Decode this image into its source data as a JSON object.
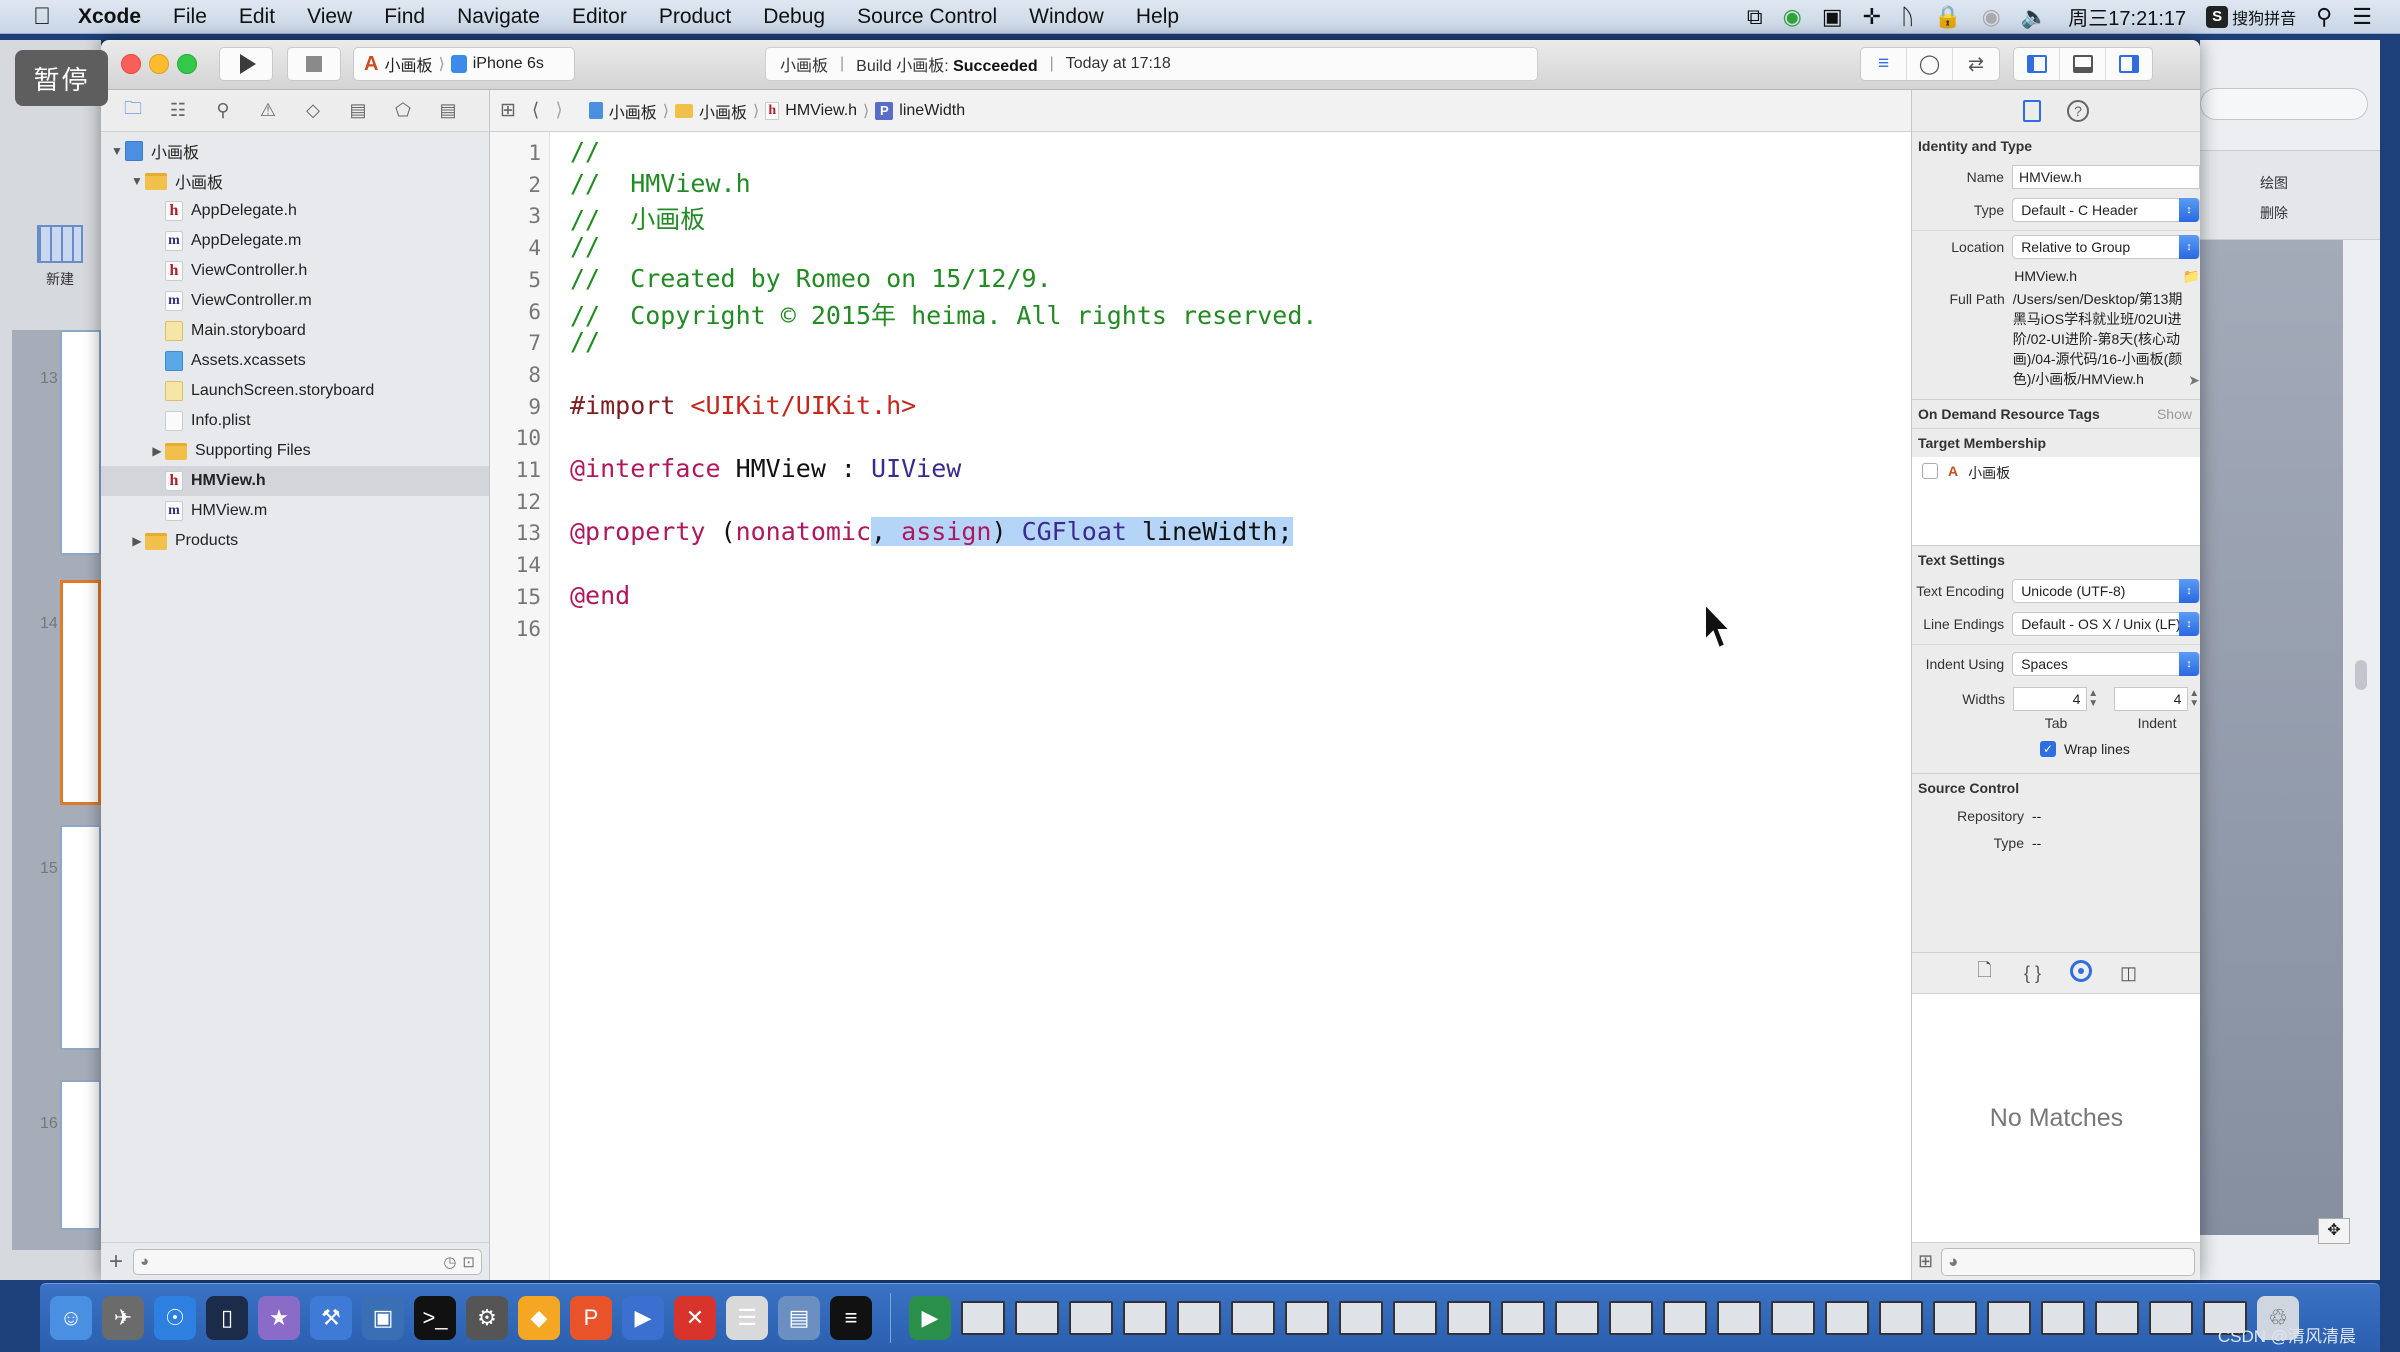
{
  "menubar": {
    "apple_icon": "apple-logo-icon",
    "items": [
      "Xcode",
      "File",
      "Edit",
      "View",
      "Find",
      "Navigate",
      "Editor",
      "Product",
      "Debug",
      "Source Control",
      "Window",
      "Help"
    ],
    "status_icons": [
      "window-switch-icon",
      "green-app-icon",
      "camera-icon",
      "plane-icon",
      "bluetooth-icon",
      "lock-icon",
      "wifi-icon",
      "volume-icon"
    ],
    "clock": "周三17:21:17",
    "input_method": "搜狗拼音",
    "search_icon": "spotlight-search-icon",
    "notification_icon": "notification-list-icon"
  },
  "overlay": {
    "pause_badge": "暂停"
  },
  "background_app": {
    "new_label": "新建",
    "slide_numbers": [
      "13",
      "14",
      "15",
      "16"
    ],
    "right_ribbon": [
      "绘图",
      "删除"
    ]
  },
  "toolbar": {
    "scheme_name": "小画板",
    "device": "iPhone 6s",
    "activity": {
      "project": "小画板",
      "build_prefix": "Build 小画板:",
      "build_status": "Succeeded",
      "time": "Today at 17:18"
    }
  },
  "navigator": {
    "tabs": [
      "project-navigator",
      "symbol-navigator",
      "find-navigator",
      "issue-navigator",
      "test-navigator",
      "debug-navigator",
      "breakpoint-navigator",
      "report-navigator"
    ],
    "tree": [
      {
        "label": "小画板",
        "type": "project",
        "level": 0,
        "expanded": true
      },
      {
        "label": "小画板",
        "type": "folder",
        "level": 1,
        "expanded": true
      },
      {
        "label": "AppDelegate.h",
        "type": "h",
        "level": 2
      },
      {
        "label": "AppDelegate.m",
        "type": "m",
        "level": 2
      },
      {
        "label": "ViewController.h",
        "type": "h",
        "level": 2
      },
      {
        "label": "ViewController.m",
        "type": "m",
        "level": 2
      },
      {
        "label": "Main.storyboard",
        "type": "storyboard",
        "level": 2
      },
      {
        "label": "Assets.xcassets",
        "type": "xcassets",
        "level": 2
      },
      {
        "label": "LaunchScreen.storyboard",
        "type": "storyboard",
        "level": 2
      },
      {
        "label": "Info.plist",
        "type": "plist",
        "level": 2
      },
      {
        "label": "Supporting Files",
        "type": "folder",
        "level": 2,
        "expanded": false
      },
      {
        "label": "HMView.h",
        "type": "h",
        "level": 2,
        "selected": true
      },
      {
        "label": "HMView.m",
        "type": "m",
        "level": 2
      },
      {
        "label": "Products",
        "type": "folder",
        "level": 1,
        "expanded": false
      }
    ]
  },
  "jumpbar": {
    "crumbs": [
      "小画板",
      "小画板",
      "HMView.h",
      "lineWidth"
    ]
  },
  "editor": {
    "lines": [
      {
        "n": "1",
        "parts": [
          {
            "t": "//",
            "c": "com"
          }
        ]
      },
      {
        "n": "2",
        "parts": [
          {
            "t": "//  HMView.h",
            "c": "com"
          }
        ]
      },
      {
        "n": "3",
        "parts": [
          {
            "t": "//  小画板",
            "c": "com"
          }
        ]
      },
      {
        "n": "4",
        "parts": [
          {
            "t": "//",
            "c": "com"
          }
        ]
      },
      {
        "n": "5",
        "parts": [
          {
            "t": "//  Created by Romeo on 15/12/9.",
            "c": "com"
          }
        ]
      },
      {
        "n": "6",
        "parts": [
          {
            "t": "//  Copyright © 2015年 heima. All rights reserved.",
            "c": "com"
          }
        ]
      },
      {
        "n": "7",
        "parts": [
          {
            "t": "//",
            "c": "com"
          }
        ]
      },
      {
        "n": "8",
        "parts": []
      },
      {
        "n": "9",
        "parts": [
          {
            "t": "#import ",
            "c": "pre"
          },
          {
            "t": "<UIKit/UIKit.h>",
            "c": "str"
          }
        ]
      },
      {
        "n": "10",
        "parts": []
      },
      {
        "n": "11",
        "parts": [
          {
            "t": "@interface",
            "c": "kw"
          },
          {
            "t": " HMView : ",
            "c": "nm"
          },
          {
            "t": "UIView",
            "c": "cls"
          }
        ]
      },
      {
        "n": "12",
        "parts": []
      },
      {
        "n": "13",
        "parts": [
          {
            "t": "@property",
            "c": "kw"
          },
          {
            "t": " (",
            "c": "nm"
          },
          {
            "t": "nonatomic",
            "c": "kw"
          },
          {
            "t": ", ",
            "c": "nm",
            "sel": true
          },
          {
            "t": "assign",
            "c": "kw",
            "sel": true
          },
          {
            "t": ") ",
            "c": "nm",
            "sel": true
          },
          {
            "t": "CGFloat",
            "c": "cls",
            "sel": true
          },
          {
            "t": " lineWidth;",
            "c": "nm",
            "sel": true
          }
        ]
      },
      {
        "n": "14",
        "parts": []
      },
      {
        "n": "15",
        "parts": [
          {
            "t": "@end",
            "c": "kw"
          }
        ]
      },
      {
        "n": "16",
        "parts": []
      }
    ]
  },
  "inspector": {
    "identity": {
      "title": "Identity and Type",
      "name_label": "Name",
      "name_value": "HMView.h",
      "type_label": "Type",
      "type_value": "Default - C Header",
      "location_label": "Location",
      "location_value": "Relative to Group",
      "location_file": "HMView.h",
      "fullpath_label": "Full Path",
      "fullpath_value": "/Users/sen/Desktop/第13期黑马iOS学科就业班/02UI进阶/02-UI进阶-第8天(核心动画)/04-源代码/16-小画板(颜色)/小画板/HMView.h"
    },
    "odr": {
      "title": "On Demand Resource Tags",
      "show_label": "Show"
    },
    "target": {
      "title": "Target Membership",
      "target_name": "小画板",
      "checked": false
    },
    "text_settings": {
      "title": "Text Settings",
      "encoding_label": "Text Encoding",
      "encoding_value": "Unicode (UTF-8)",
      "line_endings_label": "Line Endings",
      "line_endings_value": "Default - OS X / Unix (LF)",
      "indent_using_label": "Indent Using",
      "indent_using_value": "Spaces",
      "widths_label": "Widths",
      "tab_value": "4",
      "tab_label": "Tab",
      "indent_value": "4",
      "indent_label": "Indent",
      "wrap_label": "Wrap lines",
      "wrap_checked": true
    },
    "source_control": {
      "title": "Source Control",
      "repository_label": "Repository",
      "repository_value": "--",
      "type_label": "Type",
      "type_value": "--"
    },
    "library": {
      "empty_text": "No Matches"
    }
  },
  "dock": {
    "apps": [
      "finder-icon",
      "launchpad-icon",
      "safari-icon",
      "mouse-icon",
      "imovie-icon",
      "xcode-icon",
      "simulator-icon",
      "terminal-icon",
      "system-preferences-icon",
      "sketch-icon",
      "p-app-icon",
      "quicktime-icon",
      "cross-app-icon",
      "notes-icon",
      "preview-icon",
      "console-icon"
    ],
    "window_count": 24,
    "watermark": "CSDN @清风清晨"
  }
}
